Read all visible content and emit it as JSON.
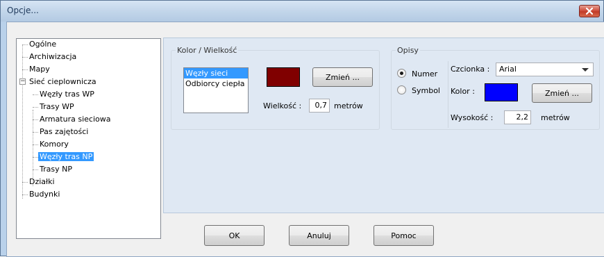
{
  "window": {
    "title": "Opcje..."
  },
  "tree": {
    "items": [
      {
        "label": "Ogólne",
        "level": 0
      },
      {
        "label": "Archiwizacja",
        "level": 0
      },
      {
        "label": "Mapy",
        "level": 0
      },
      {
        "label": "Sieć cieplownicza",
        "level": 0,
        "expanded": true
      },
      {
        "label": "Węzły tras WP",
        "level": 1
      },
      {
        "label": "Trasy WP",
        "level": 1
      },
      {
        "label": "Armatura sieciowa",
        "level": 1
      },
      {
        "label": "Pas zajętości",
        "level": 1
      },
      {
        "label": "Komory",
        "level": 1
      },
      {
        "label": "Węzły tras NP",
        "level": 1,
        "selected": true
      },
      {
        "label": "Trasy NP",
        "level": 1
      },
      {
        "label": "Działki",
        "level": 0
      },
      {
        "label": "Budynki",
        "level": 0
      }
    ]
  },
  "color_size": {
    "legend": "Kolor / Wielkość",
    "list": [
      "Węzły sieci",
      "Odbiorcy ciepła"
    ],
    "selected_index": 0,
    "swatch_color": "#800000",
    "change_label": "Zmień ...",
    "size_label": "Wielkość :",
    "size_value": "0,7",
    "size_unit": "metrów"
  },
  "descriptions": {
    "legend": "Opisy",
    "radio_number": "Numer",
    "radio_symbol": "Symbol",
    "selected_radio": "Numer",
    "font_label": "Czcionka :",
    "font_value": "Arial",
    "color_label": "Kolor :",
    "color_swatch": "#0000ff",
    "change_label": "Zmień ...",
    "height_label": "Wysokość :",
    "height_value": "2,2",
    "height_unit": "metrów"
  },
  "buttons": {
    "ok": "OK",
    "cancel": "Anuluj",
    "help": "Pomoc"
  }
}
